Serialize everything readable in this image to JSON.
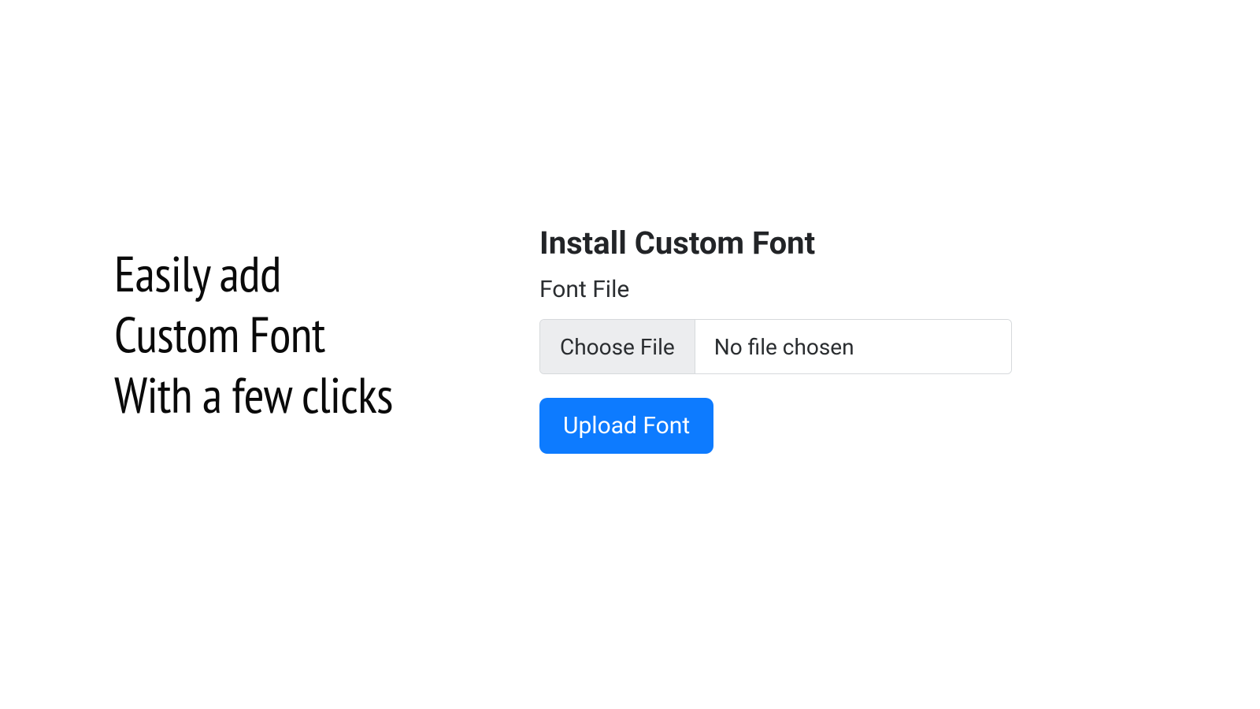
{
  "tagline": {
    "line1": "Easily add",
    "line2": "Custom Font",
    "line3": "With a few clicks"
  },
  "form": {
    "title": "Install Custom Font",
    "label": "Font File",
    "choose_button": "Choose File",
    "file_status": "No file chosen",
    "upload_button": "Upload Font"
  },
  "colors": {
    "primary": "#0d7bff",
    "text_dark": "#222427",
    "text_body": "#2a2d30",
    "border": "#d6d9dc",
    "button_bg": "#ecedef"
  }
}
